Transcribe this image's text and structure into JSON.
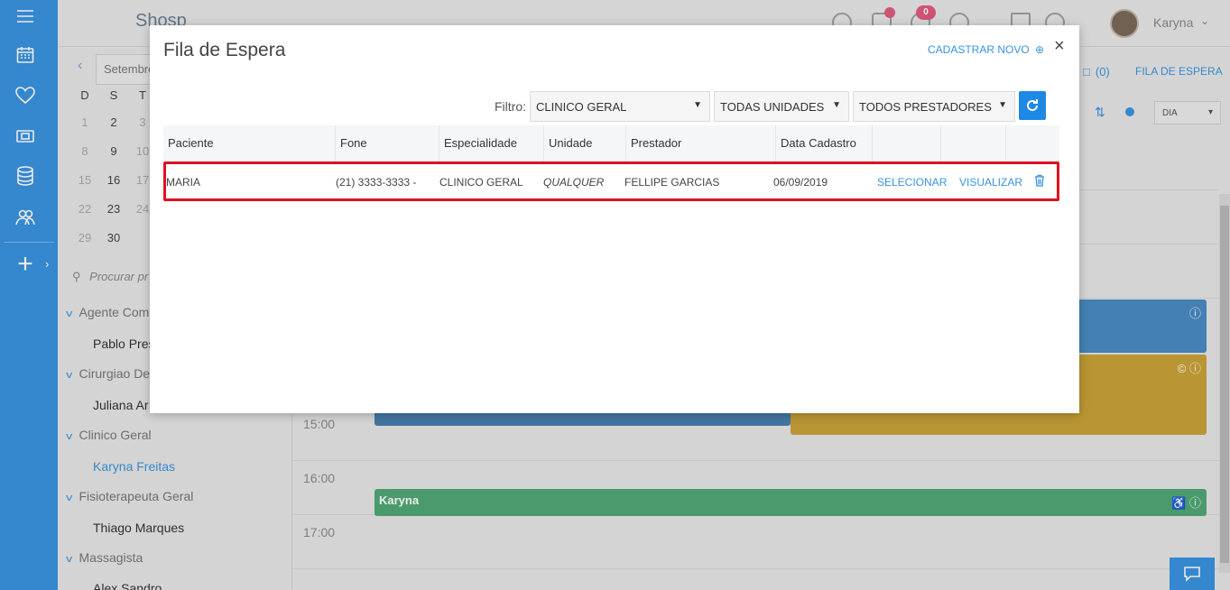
{
  "app": {
    "logo_text": "Shosp",
    "username": "Karyna",
    "notif_badge": "0"
  },
  "calendar": {
    "month_label": "Setembro",
    "weekdays": [
      "D",
      "S",
      "T"
    ],
    "rows": [
      [
        "1",
        "2",
        "3"
      ],
      [
        "8",
        "9",
        "10"
      ],
      [
        "15",
        "16",
        "17"
      ],
      [
        "22",
        "23",
        "24"
      ],
      [
        "29",
        "30",
        ""
      ]
    ]
  },
  "sidebar_list": {
    "search_placeholder": "Procurar pr",
    "groups": [
      {
        "label": "Agente Com",
        "member": "Pablo Pres"
      },
      {
        "label": "Cirurgiao De",
        "member": "Juliana Ar"
      },
      {
        "label": "Clinico Geral",
        "member": "Karyna Freitas"
      },
      {
        "label": "Fisioterapeuta Geral",
        "member": "Thiago Marques"
      },
      {
        "label": "Massagista",
        "member": "Alex Sandro"
      }
    ]
  },
  "right_toolbar": {
    "count": "(0)",
    "fila_link": "FILA DE ESPERA",
    "view_select": "DIA"
  },
  "schedule": {
    "times": [
      "15:00",
      "16:00",
      "17:00"
    ],
    "green_event_label": "Karyna"
  },
  "modal": {
    "title": "Fila de Espera",
    "cadastrar_novo": "CADASTRAR NOVO",
    "close": "×",
    "filter_label": "Filtro:",
    "filters": {
      "especialidade": "CLINICO GERAL",
      "unidades": "TODAS UNIDADES",
      "prestadores": "TODOS PRESTADORES"
    },
    "columns": [
      "Paciente",
      "Fone",
      "Especialidade",
      "Unidade",
      "Prestador",
      "Data Cadastro"
    ],
    "row": {
      "paciente": "MARIA",
      "fone": "(21) 3333-3333 -",
      "especialidade": "CLINICO GERAL",
      "unidade": "QUALQUER",
      "prestador": "FELLIPE GARCIAS",
      "data_cadastro": "06/09/2019",
      "selecionar": "SELECIONAR",
      "visualizar": "VISUALIZAR"
    }
  }
}
